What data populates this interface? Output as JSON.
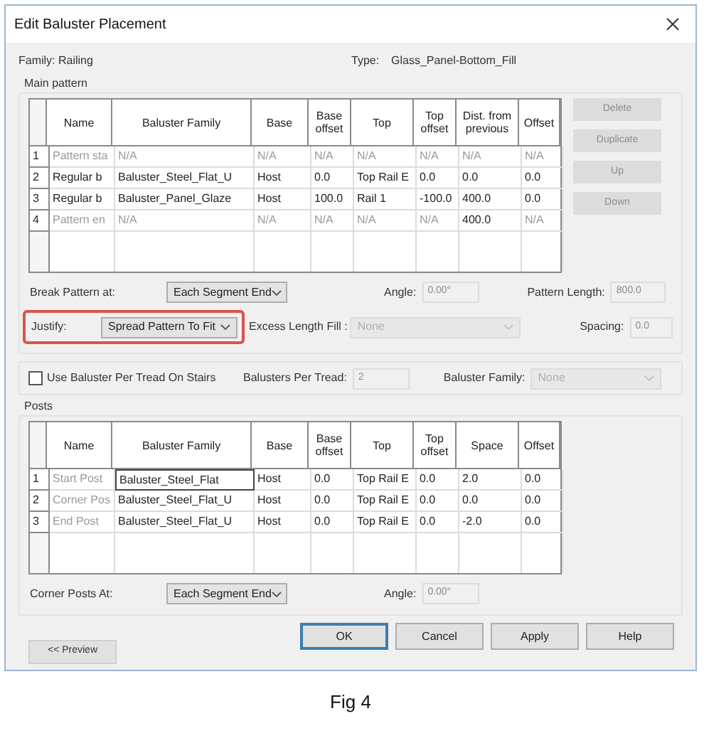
{
  "window": {
    "title": "Edit Baluster Placement"
  },
  "family": {
    "label": "Family:",
    "value": "Railing"
  },
  "type": {
    "label": "Type:",
    "value": "Glass_Panel-Bottom_Fill"
  },
  "main_pattern": {
    "title": "Main pattern",
    "columns": [
      "Name",
      "Baluster Family",
      "Base",
      "Base offset",
      "Top",
      "Top offset",
      "Dist. from previous",
      "Offset"
    ],
    "rows": [
      {
        "number": "1",
        "cells": [
          {
            "text": "Pattern sta",
            "dimmed": true
          },
          {
            "text": "N/A",
            "dimmed": true
          },
          {
            "text": "N/A",
            "dimmed": true
          },
          {
            "text": "N/A",
            "dimmed": true
          },
          {
            "text": "N/A",
            "dimmed": true
          },
          {
            "text": "N/A",
            "dimmed": true
          },
          {
            "text": "N/A",
            "dimmed": true
          },
          {
            "text": "N/A",
            "dimmed": true
          }
        ]
      },
      {
        "number": "2",
        "cells": [
          {
            "text": "Regular b",
            "dimmed": false
          },
          {
            "text": "Baluster_Steel_Flat_U",
            "dimmed": false
          },
          {
            "text": "Host",
            "dimmed": false
          },
          {
            "text": "0.0",
            "dimmed": false
          },
          {
            "text": "Top Rail E",
            "dimmed": false
          },
          {
            "text": "0.0",
            "dimmed": false
          },
          {
            "text": "0.0",
            "dimmed": false
          },
          {
            "text": "0.0",
            "dimmed": false
          }
        ]
      },
      {
        "number": "3",
        "cells": [
          {
            "text": "Regular b",
            "dimmed": false
          },
          {
            "text": "Baluster_Panel_Glaze",
            "dimmed": false
          },
          {
            "text": "Host",
            "dimmed": false
          },
          {
            "text": "100.0",
            "dimmed": false
          },
          {
            "text": "Rail 1",
            "dimmed": false
          },
          {
            "text": "-100.0",
            "dimmed": false
          },
          {
            "text": "400.0",
            "dimmed": false
          },
          {
            "text": "0.0",
            "dimmed": false
          }
        ]
      },
      {
        "number": "4",
        "cells": [
          {
            "text": "Pattern en",
            "dimmed": true
          },
          {
            "text": "N/A",
            "dimmed": true
          },
          {
            "text": "N/A",
            "dimmed": true
          },
          {
            "text": "N/A",
            "dimmed": true
          },
          {
            "text": "N/A",
            "dimmed": true
          },
          {
            "text": "N/A",
            "dimmed": true
          },
          {
            "text": "400.0",
            "dimmed": false
          },
          {
            "text": "N/A",
            "dimmed": true
          }
        ]
      }
    ],
    "buttons": [
      {
        "label": "Delete",
        "disabled": true
      },
      {
        "label": "Duplicate",
        "disabled": true
      },
      {
        "label": "Up",
        "disabled": true
      },
      {
        "label": "Down",
        "disabled": true
      }
    ]
  },
  "break_pattern": {
    "label": "Break Pattern at:",
    "value": "Each Segment End",
    "disabled": false
  },
  "angle": {
    "label": "Angle:",
    "value": "0.00°",
    "disabled": true
  },
  "pattern_length": {
    "label": "Pattern Length:",
    "value": "800.0",
    "disabled": true
  },
  "justify": {
    "label": "Justify:",
    "value": "Spread Pattern To Fit",
    "disabled": false,
    "highlighted": true
  },
  "excess_length_fill": {
    "label": "Excess Length Fill :",
    "value": "None",
    "disabled": true
  },
  "spacing": {
    "label": "Spacing:",
    "value": "0.0",
    "disabled": true
  },
  "use_per_tread": {
    "label": "Use Baluster Per Tread On Stairs",
    "checked": false
  },
  "balusters_per_tread": {
    "label": "Balusters Per Tread:",
    "value": "2",
    "disabled": true
  },
  "baluster_family": {
    "label": "Baluster Family:",
    "value": "None",
    "disabled": true
  },
  "posts": {
    "title": "Posts",
    "columns": [
      "Name",
      "Baluster Family",
      "Base",
      "Base offset",
      "Top",
      "Top offset",
      "Space",
      "Offset"
    ],
    "rows": [
      {
        "number": "1",
        "cells": [
          {
            "text": "Start Post",
            "dimmed": true,
            "focused": false
          },
          {
            "text": "Baluster_Steel_Flat",
            "dimmed": false,
            "focused": true
          },
          {
            "text": "Host",
            "dimmed": false,
            "focused": false
          },
          {
            "text": "0.0",
            "dimmed": false,
            "focused": false
          },
          {
            "text": "Top Rail E",
            "dimmed": false,
            "focused": false
          },
          {
            "text": "0.0",
            "dimmed": false,
            "focused": false
          },
          {
            "text": "2.0",
            "dimmed": false,
            "focused": false
          },
          {
            "text": "0.0",
            "dimmed": false,
            "focused": false
          }
        ]
      },
      {
        "number": "2",
        "cells": [
          {
            "text": "Corner Pos",
            "dimmed": true,
            "focused": false
          },
          {
            "text": "Baluster_Steel_Flat_U",
            "dimmed": false,
            "focused": false
          },
          {
            "text": "Host",
            "dimmed": false,
            "focused": false
          },
          {
            "text": "0.0",
            "dimmed": false,
            "focused": false
          },
          {
            "text": "Top Rail E",
            "dimmed": false,
            "focused": false
          },
          {
            "text": "0.0",
            "dimmed": false,
            "focused": false
          },
          {
            "text": "0.0",
            "dimmed": false,
            "focused": false
          },
          {
            "text": "0.0",
            "dimmed": false,
            "focused": false
          }
        ]
      },
      {
        "number": "3",
        "cells": [
          {
            "text": "End Post",
            "dimmed": true,
            "focused": false
          },
          {
            "text": "Baluster_Steel_Flat_U",
            "dimmed": false,
            "focused": false
          },
          {
            "text": "Host",
            "dimmed": false,
            "focused": false
          },
          {
            "text": "0.0",
            "dimmed": false,
            "focused": false
          },
          {
            "text": "Top Rail E",
            "dimmed": false,
            "focused": false
          },
          {
            "text": "0.0",
            "dimmed": false,
            "focused": false
          },
          {
            "text": "-2.0",
            "dimmed": false,
            "focused": false
          },
          {
            "text": "0.0",
            "dimmed": false,
            "focused": false
          }
        ]
      }
    ]
  },
  "corner_posts": {
    "label": "Corner Posts At:",
    "value": "Each Segment End",
    "disabled": false
  },
  "corner_angle": {
    "label": "Angle:",
    "value": "0.00°",
    "disabled": true
  },
  "buttons": [
    {
      "label": "OK",
      "default": true
    },
    {
      "label": "Cancel",
      "default": false
    },
    {
      "label": "Apply",
      "default": false
    },
    {
      "label": "Help",
      "default": false
    }
  ],
  "preview_button": {
    "label": "<< Preview"
  },
  "caption": "Fig 4"
}
